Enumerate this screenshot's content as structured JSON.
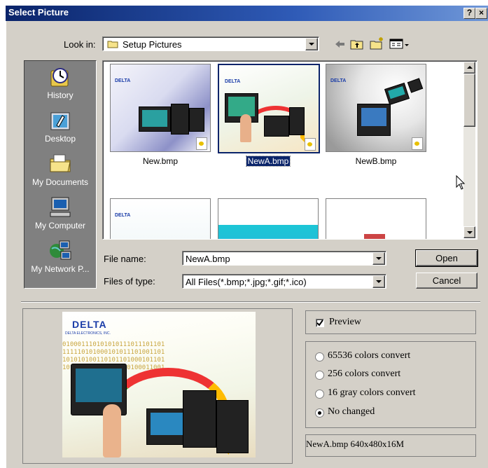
{
  "window": {
    "title": "Select Picture",
    "help_label": "?",
    "close_label": "×"
  },
  "look_in": {
    "label": "Look in:",
    "value": "Setup Pictures"
  },
  "places": [
    {
      "label": "History",
      "icon": "history-icon"
    },
    {
      "label": "Desktop",
      "icon": "desktop-icon"
    },
    {
      "label": "My Documents",
      "icon": "my-documents-icon"
    },
    {
      "label": "My Computer",
      "icon": "my-computer-icon"
    },
    {
      "label": "My Network P...",
      "icon": "my-network-icon"
    }
  ],
  "files": [
    {
      "name": "New.bmp",
      "selected": false
    },
    {
      "name": "NewA.bmp",
      "selected": true
    },
    {
      "name": "NewB.bmp",
      "selected": false
    },
    {
      "name": "",
      "selected": false
    },
    {
      "name": "",
      "selected": false
    },
    {
      "name": "",
      "selected": false
    }
  ],
  "brand": {
    "delta": "DELTA",
    "delta_sub": "DELTA ELECTRONICS, INC."
  },
  "file_name": {
    "label": "File name:",
    "value": "NewA.bmp"
  },
  "file_type": {
    "label": "Files of type:",
    "value": "All Files(*.bmp;*.jpg;*.gif;*.ico)"
  },
  "buttons": {
    "open": "Open",
    "cancel": "Cancel"
  },
  "preview": {
    "checkbox_label": "Preview",
    "checked": true,
    "binary_rows": [
      "010001110101010111011101101",
      "111110101000101011101001101",
      "101010100110101101000101101",
      "101010011110110010100011001"
    ]
  },
  "convert_options": [
    {
      "label": "65536 colors convert",
      "selected": false
    },
    {
      "label": "256 colors convert",
      "selected": false
    },
    {
      "label": "16 gray colors convert",
      "selected": false
    },
    {
      "label": "No changed",
      "selected": true
    }
  ],
  "info": "NewA.bmp 640x480x16M",
  "colors": {
    "title_bar": "#0a246a",
    "face": "#d4d0c8",
    "selection": "#0a246a"
  }
}
